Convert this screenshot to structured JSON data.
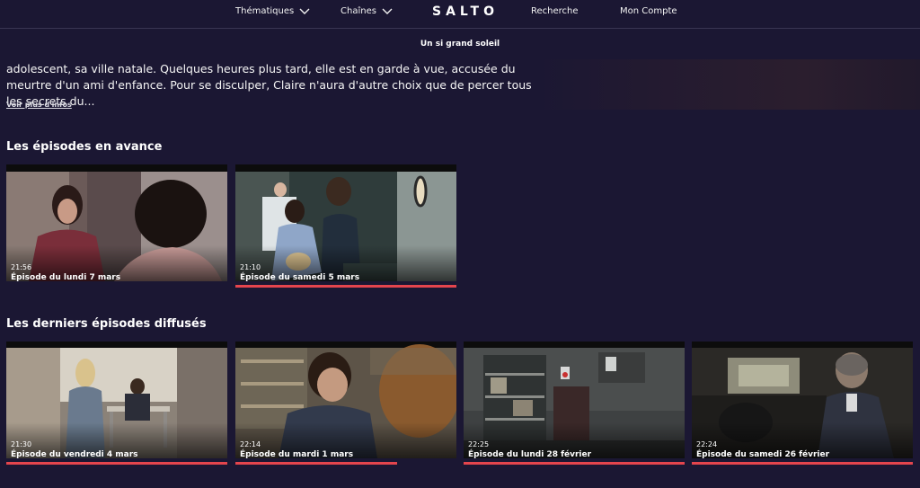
{
  "nav": {
    "themes": "Thématiques",
    "channels": "Chaînes",
    "logo": "SALTO",
    "search": "Recherche",
    "account": "Mon Compte"
  },
  "show": {
    "title": "Un si grand soleil",
    "synopsis": "adolescent, sa ville natale. Quelques heures plus tard, elle est en garde à vue, accusée du meurtre d'un ami d'enfance. Pour se disculper, Claire n'aura d'autre choix que de percer tous les secrets du...",
    "more_link": "Voir plus d'infos"
  },
  "sections": {
    "upcoming": {
      "title": "Les épisodes en avance",
      "episodes": [
        {
          "time": "21:56",
          "title": "Épisode du lundi 7 mars",
          "progress": 0
        },
        {
          "time": "21:10",
          "title": "Épisode du samedi 5 mars",
          "progress": 1.0
        }
      ]
    },
    "latest": {
      "title": "Les derniers épisodes diffusés",
      "episodes": [
        {
          "time": "21:30",
          "title": "Épisode du vendredi 4 mars",
          "progress": 1.0
        },
        {
          "time": "22:14",
          "title": "Épisode du mardi 1 mars",
          "progress": 0.73
        },
        {
          "time": "22:25",
          "title": "Épisode du lundi 28 février",
          "progress": 1.0
        },
        {
          "time": "22:24",
          "title": "Épisode du samedi 26 février",
          "progress": 1.0
        }
      ]
    }
  },
  "colors": {
    "background": "#1b1733",
    "progress": "#e4454d"
  }
}
